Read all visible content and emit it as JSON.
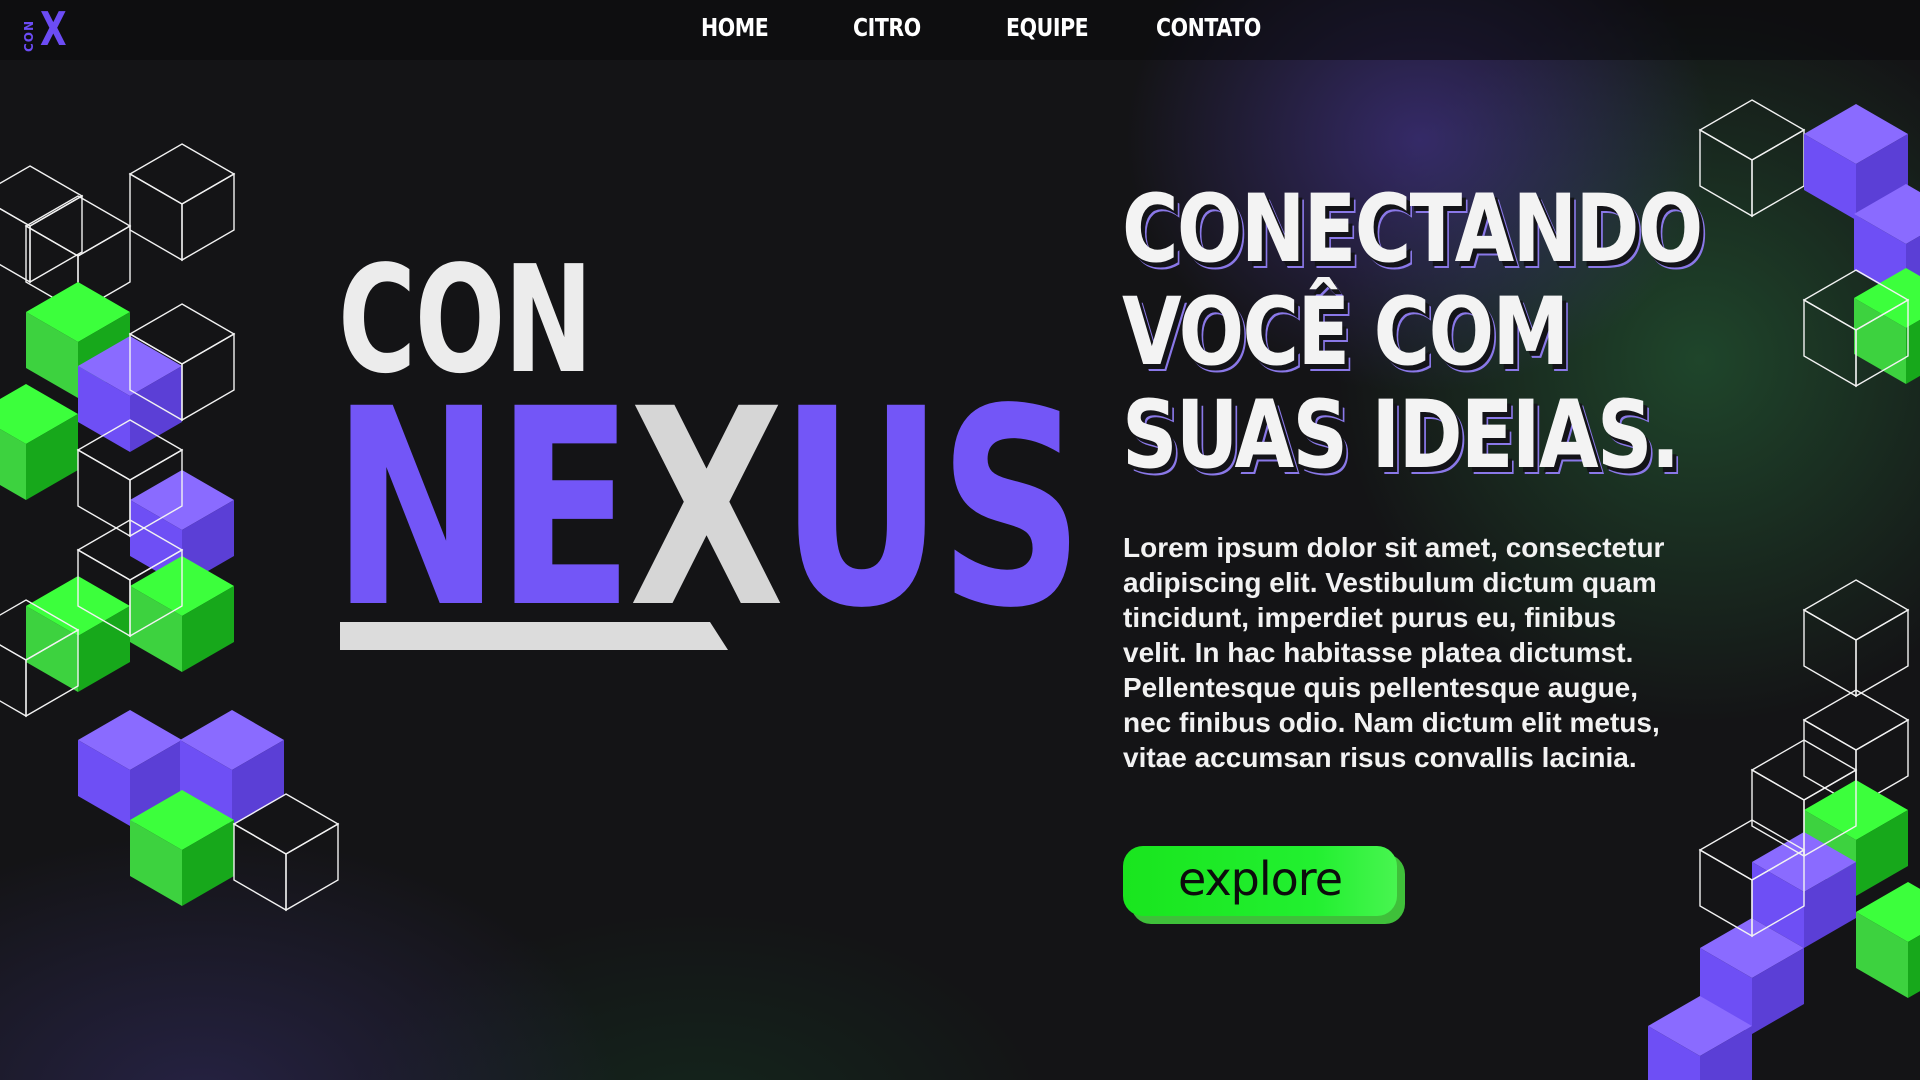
{
  "logo": {
    "top_text": "CON",
    "mark": "X"
  },
  "nav": {
    "items": [
      "HOME",
      "CITRO",
      "EQUIPE",
      "CONTATO"
    ]
  },
  "brand": {
    "line1": "CON",
    "line2_part1": "NE",
    "line2_part2": "X",
    "line2_part3": "US"
  },
  "hero": {
    "headline": [
      "CONECTANDO",
      "VOCÊ COM",
      "SUAS IDEIAS."
    ],
    "body": "Lorem ipsum dolor sit amet, consectetur adipiscing elit. Vestibulum dictum quam tincidunt, imperdiet purus eu, finibus velit. In hac habitasse platea dictumst. Pellentesque quis pellentesque augue, nec finibus odio. Nam dictum elit metus, vitae accumsan risus convallis lacinia.",
    "cta_label": "explore"
  },
  "colors": {
    "purple": "#7356f7",
    "green": "#22f030",
    "background": "#141416",
    "text": "#f3f3f3"
  }
}
